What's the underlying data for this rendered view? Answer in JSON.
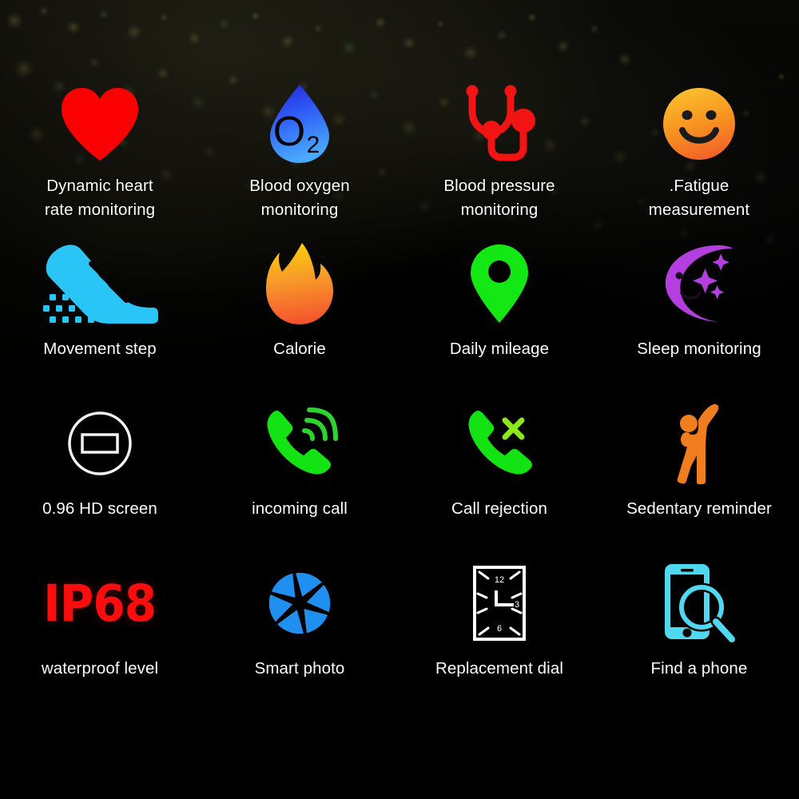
{
  "page": {
    "title": "Smart band feature icon grid",
    "background_color": "#000000",
    "text_color": "#fdfdfd"
  },
  "features": [
    {
      "id": "dynamic-heart-rate",
      "icon": "heart-icon",
      "label": "Dynamic heart\nrate monitoring",
      "color": "#fb0000"
    },
    {
      "id": "blood-oxygen",
      "icon": "water-drop-o2-icon",
      "label": "Blood oxygen\nmonitoring",
      "color": "#2b4bf2",
      "color_secondary": "#3f9dff"
    },
    {
      "id": "blood-pressure",
      "icon": "stethoscope-icon",
      "label": "Blood pressure\nmonitoring",
      "color": "#f21313"
    },
    {
      "id": "fatigue-measurement",
      "icon": "smiley-face-icon",
      "label": ".Fatigue\nmeasurement",
      "color": "#f7b733",
      "color_secondary": "#f25c26"
    },
    {
      "id": "movement-step",
      "icon": "running-shoe-icon",
      "label": "Movement step",
      "color": "#29c5f6"
    },
    {
      "id": "calorie",
      "icon": "flame-icon",
      "label": "Calorie",
      "color": "#f9c10a",
      "color_secondary": "#f4552a"
    },
    {
      "id": "daily-mileage",
      "icon": "location-pin-icon",
      "label": "Daily mileage",
      "color": "#14e814"
    },
    {
      "id": "sleep-monitoring",
      "icon": "crescent-moon-icon",
      "label": "Sleep monitoring",
      "color": "#b43ee0"
    },
    {
      "id": "hd-screen",
      "icon": "screen-circle-icon",
      "label": "0.96 HD screen",
      "color": "#ffffff"
    },
    {
      "id": "incoming-call",
      "icon": "incoming-call-icon",
      "label": "incoming call",
      "color": "#13e313"
    },
    {
      "id": "call-rejection",
      "icon": "call-reject-icon",
      "label": "Call rejection",
      "color": "#13e313"
    },
    {
      "id": "sedentary-reminder",
      "icon": "stretching-person-icon",
      "label": "Sedentary reminder",
      "color": "#f07e1e"
    },
    {
      "id": "waterproof-level",
      "icon": "ip68-wordmark",
      "icon_text": "IP68",
      "label": "waterproof level",
      "color": "#fb0d0d"
    },
    {
      "id": "smart-photo",
      "icon": "camera-aperture-icon",
      "label": "Smart photo",
      "color": "#1f8ff0"
    },
    {
      "id": "replacement-dial",
      "icon": "watch-dial-icon",
      "label": "Replacement dial",
      "color": "#ffffff",
      "dial_numbers": [
        "12",
        "3",
        "6"
      ]
    },
    {
      "id": "find-a-phone",
      "icon": "phone-search-icon",
      "label": "Find a phone",
      "color": "#4fd8f0"
    }
  ]
}
